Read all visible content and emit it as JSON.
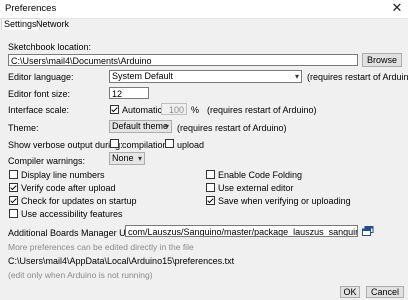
{
  "window": {
    "title": "Preferences",
    "close_glyph": "✕"
  },
  "tabs": [
    {
      "label": "Settings"
    },
    {
      "label": "Network"
    }
  ],
  "sketchbook": {
    "label": "Sketchbook location:",
    "value": "C:\\Users\\mail4\\Documents\\Arduino",
    "browse_label": "Browse"
  },
  "language": {
    "label": "Editor language:",
    "value": "System Default",
    "note": "(requires restart of Arduino)"
  },
  "font_size": {
    "label": "Editor font size:",
    "value": "12"
  },
  "scale": {
    "label": "Interface scale:",
    "automatic_label": "Automatic",
    "automatic_checked": true,
    "value": "100",
    "unit": "%",
    "note": "(requires restart of Arduino)"
  },
  "theme": {
    "label": "Theme:",
    "value": "Default theme",
    "note": "(requires restart of Arduino)"
  },
  "verbose": {
    "label": "Show verbose output during:",
    "compilation_label": "compilation",
    "compilation_checked": false,
    "upload_label": "upload",
    "upload_checked": false
  },
  "warnings": {
    "label": "Compiler warnings:",
    "value": "None"
  },
  "options_left": [
    {
      "label": "Display line numbers",
      "checked": false
    },
    {
      "label": "Verify code after upload",
      "checked": true
    },
    {
      "label": "Check for updates on startup",
      "checked": true
    },
    {
      "label": "Use accessibility features",
      "checked": false
    }
  ],
  "options_right": [
    {
      "label": "Enable Code Folding",
      "checked": false
    },
    {
      "label": "Use external editor",
      "checked": false
    },
    {
      "label": "Save when verifying or uploading",
      "checked": true
    }
  ],
  "boards_manager": {
    "label": "Additional Boards Manager URLs:",
    "value": "com/Lauszus/Sanguino/master/package_lauszus_sanguino_index.json"
  },
  "more_prefs": {
    "text": "More preferences can be edited directly in the file",
    "path": "C:\\Users\\mail4\\AppData\\Local\\Arduino15\\preferences.txt",
    "note": "(edit only when Arduino is not running)"
  },
  "footer": {
    "ok_label": "OK",
    "cancel_label": "Cancel"
  },
  "icons": {
    "open_list": "open-window-icon",
    "check": "checkmark-icon",
    "dropdown": "chevron-down-icon"
  }
}
